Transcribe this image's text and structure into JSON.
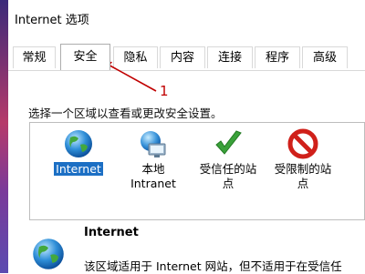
{
  "window": {
    "title": "Internet 选项"
  },
  "tabs": [
    {
      "label": "常规",
      "active": false
    },
    {
      "label": "安全",
      "active": true
    },
    {
      "label": "隐私",
      "active": false
    },
    {
      "label": "内容",
      "active": false
    },
    {
      "label": "连接",
      "active": false
    },
    {
      "label": "程序",
      "active": false
    },
    {
      "label": "高级",
      "active": false
    }
  ],
  "annotation": {
    "number": "1",
    "color": "#c00000"
  },
  "security": {
    "instruction": "选择一个区域以查看或更改安全设置。",
    "zones": [
      {
        "line1": "Internet",
        "line2": "",
        "icon": "globe-icon",
        "selected": true
      },
      {
        "line1": "本地",
        "line2": "Intranet",
        "icon": "intranet-icon",
        "selected": false
      },
      {
        "line1": "受信任的站",
        "line2": "点",
        "icon": "checkmark-icon",
        "selected": false
      },
      {
        "line1": "受限制的站",
        "line2": "点",
        "icon": "prohibited-icon",
        "selected": false
      }
    ],
    "detail": {
      "title": "Internet",
      "description": "该区域适用于 Internet 网站，但不适用于在受信任"
    }
  },
  "colors": {
    "selection": "#1c6fc4",
    "trusted_green": "#3aa13a",
    "restricted_red": "#d0201a"
  }
}
